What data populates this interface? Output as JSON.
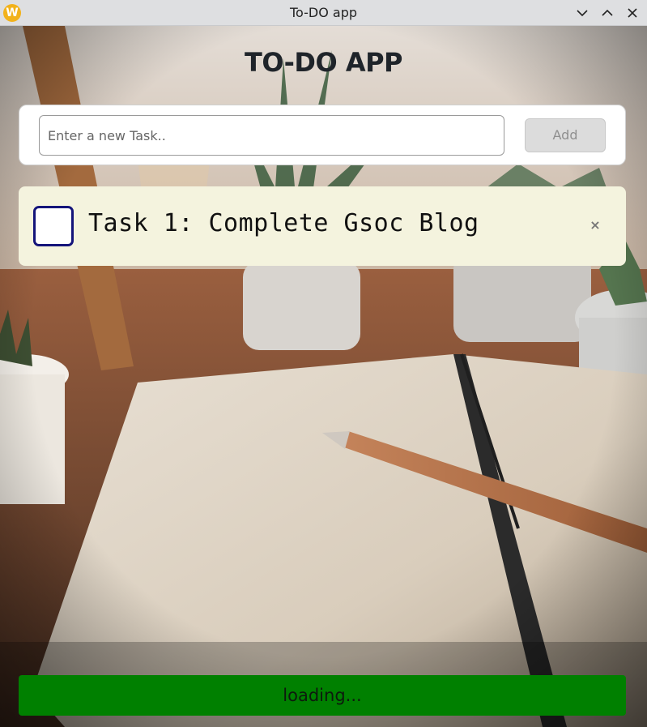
{
  "window": {
    "title": "To-DO app",
    "icon": "app-logo-icon",
    "controls": [
      "minimize-icon",
      "maximize-icon",
      "close-icon"
    ]
  },
  "app": {
    "heading": "TO-DO APP"
  },
  "input": {
    "placeholder": "Enter a new Task..",
    "value": "",
    "add_label": "Add"
  },
  "tasks": [
    {
      "text": "Task 1: Complete Gsoc Blog",
      "checked": false,
      "delete_label": "×"
    }
  ],
  "status": {
    "text": "loading..."
  },
  "colors": {
    "loading_bar": "#008000",
    "task_card": "#f4f3de",
    "checkbox_border": "#14147a",
    "add_button_disabled": "#dcdcdc"
  }
}
